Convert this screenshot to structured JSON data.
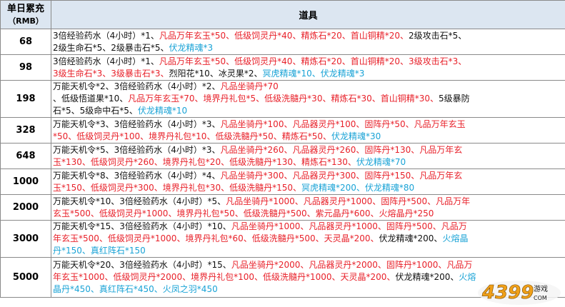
{
  "header": {
    "col1": [
      "单日累充",
      "（RMB）"
    ],
    "col2": "道具"
  },
  "rows": [
    {
      "amount": "68",
      "lines": [
        [
          [
            "k",
            "3倍经验药水（4小时）*1、"
          ],
          [
            "r",
            "凡品万年玄玉*50、低级饲灵丹*40、精炼石*20、首山铜精*20、"
          ],
          [
            "k",
            "2级攻击石*5、"
          ]
        ],
        [
          [
            "k",
            "2级生命石*5、2级暴击石*5、"
          ],
          [
            "b",
            "伏龙精魂*3"
          ]
        ]
      ]
    },
    {
      "amount": "98",
      "lines": [
        [
          [
            "k",
            "3倍经验药水（4小时）*1、"
          ],
          [
            "r",
            "凡品万年玄玉*50、低级饲灵丹*40、精炼石*20、首山铜精*20、3级攻击石*3、"
          ]
        ],
        [
          [
            "r",
            "3级生命石*3、3级暴击石*3、"
          ],
          [
            "k",
            "烈阳花*10、冰灵果*2、"
          ],
          [
            "b",
            "冥虎精魂*10、伏龙精魂*3"
          ]
        ]
      ]
    },
    {
      "amount": "198",
      "lines": [
        [
          [
            "k",
            "万能天机令*2、3倍经验药水（4小时）*2、"
          ],
          [
            "r",
            "凡品坐骑丹*70"
          ]
        ],
        [
          [
            "k",
            "、低级悟道果*10、"
          ],
          [
            "r",
            "凡品万年玄玉*70、境界丹礼包*5、低级洗髓丹*30、精炼石*30、首山铜精*30、"
          ],
          [
            "k",
            "5级暴防"
          ]
        ],
        [
          [
            "k",
            "石*5、5级命中石*5、"
          ],
          [
            "b",
            "伏龙精魂*10"
          ]
        ]
      ]
    },
    {
      "amount": "328",
      "lines": [
        [
          [
            "k",
            "万能天机令*3、3倍经验药水（4小时）*3、"
          ],
          [
            "r",
            "凡品坐骑丹*100、凡品器灵丹*100、固阵丹*50、凡品万年玄玉"
          ]
        ],
        [
          [
            "r",
            "*50、低级饲灵丹*100、境界丹礼包*10、低级洗髓丹*50、精炼石*50、"
          ],
          [
            "b",
            "伏龙精魂*30"
          ]
        ]
      ]
    },
    {
      "amount": "648",
      "lines": [
        [
          [
            "k",
            "万能天机令*5、3倍经验药水（4小时）*3、"
          ],
          [
            "r",
            "凡品坐骑丹*260、凡品器灵丹*260、固阵丹*130、凡品万年玄"
          ]
        ],
        [
          [
            "r",
            "玉*130、低级饲灵丹*260、境界丹礼包*20、低级洗髓丹*130、精炼石*130、"
          ],
          [
            "b",
            "伏龙精魂*70"
          ]
        ]
      ]
    },
    {
      "amount": "1000",
      "lines": [
        [
          [
            "k",
            "万能天机令*8、3倍经验药水（4小时）*4、"
          ],
          [
            "r",
            "凡品坐骑丹*300、凡品器灵丹*300、固阵丹*150、凡品万年玄"
          ]
        ],
        [
          [
            "r",
            "玉*150、低级饲灵丹*300、境界丹礼包*30、低级洗髓丹*150、"
          ],
          [
            "b",
            "冥虎精魂*200、伏龙精魂*80"
          ]
        ]
      ]
    },
    {
      "amount": "2000",
      "lines": [
        [
          [
            "k",
            "万能天机令*10、3倍经验药水（4小时）*5、"
          ],
          [
            "r",
            "凡品坐骑丹*1000、凡品器灵丹*1000、固阵丹*500、凡品万年"
          ]
        ],
        [
          [
            "r",
            "玄玉*500、低级饲灵丹*1000、境界丹礼包*50、低级洗髓丹*500、紫元晶丹*600、火熔晶丹*250"
          ]
        ]
      ]
    },
    {
      "amount": "3000",
      "lines": [
        [
          [
            "k",
            "万能天机令*15、3倍经验药水（4小时）*10、"
          ],
          [
            "r",
            "凡品坐骑丹*1000、凡品器灵丹*1000、固阵丹*500、凡品万"
          ]
        ],
        [
          [
            "r",
            "年玄玉*500、低级饲灵丹*1000、境界丹礼包*60、低级洗髓丹*500、天灵晶*200、"
          ],
          [
            "k",
            "伏龙精魂*200、"
          ],
          [
            "b",
            "火熔晶"
          ]
        ],
        [
          [
            "b",
            "丹*150、真红阵石*150"
          ]
        ]
      ]
    },
    {
      "amount": "5000",
      "lines": [
        [
          [
            "k",
            "万能天机令*20、3倍经验药水（4小时）*15、"
          ],
          [
            "r",
            "凡品坐骑丹*2000、凡品器灵丹*2000、固阵丹*1000、凡品万"
          ]
        ],
        [
          [
            "r",
            "年玄玉*1000、低级饲灵丹*2000、境界丹礼包*100、低级洗髓丹*1000、天灵晶*200、"
          ],
          [
            "k",
            "伏龙精魂*200、"
          ],
          [
            "b",
            "火熔"
          ]
        ],
        [
          [
            "b",
            "晶丹*450、真红阵石*450、火凤之羽*450"
          ]
        ]
      ]
    }
  ],
  "watermark": {
    "brand": "4399",
    "sub": "游戏"
  }
}
